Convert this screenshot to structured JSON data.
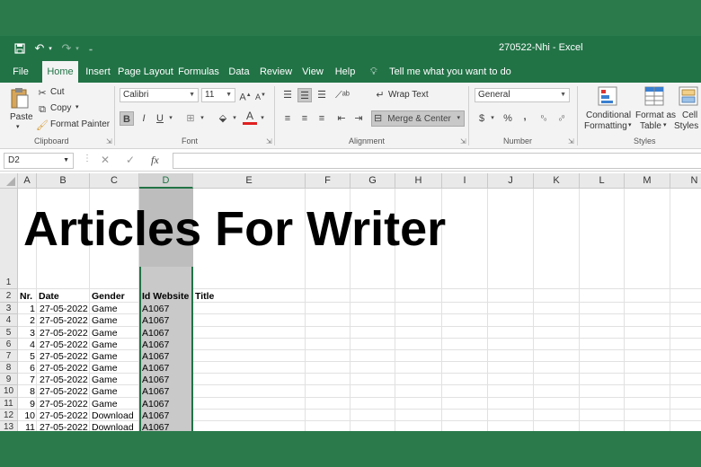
{
  "window": {
    "title": "270522-Nhi  -  Excel"
  },
  "tabs": [
    "File",
    "Home",
    "Insert",
    "Page Layout",
    "Formulas",
    "Data",
    "Review",
    "View",
    "Help"
  ],
  "tell_me": "Tell me what you want to do",
  "ribbon": {
    "clipboard": {
      "label": "Clipboard",
      "paste": "Paste",
      "cut": "Cut",
      "copy": "Copy",
      "format_painter": "Format Painter"
    },
    "font": {
      "label": "Font",
      "family": "Calibri",
      "size": "11",
      "bold": "B",
      "italic": "I",
      "underline": "U"
    },
    "alignment": {
      "label": "Alignment",
      "wrap_text": "Wrap Text",
      "merge_center": "Merge & Center"
    },
    "number": {
      "label": "Number",
      "format": "General",
      "currency": "$",
      "percent": "%",
      "comma": ","
    },
    "styles": {
      "label": "Styles",
      "conditional": "Conditional",
      "formatting": "Formatting",
      "format_as": "Format as",
      "table": "Table",
      "cell": "Cell",
      "styles": "Styles"
    }
  },
  "formula_bar": {
    "name_box": "D2",
    "fx": "fx",
    "value": ""
  },
  "columns": [
    "A",
    "B",
    "C",
    "D",
    "E",
    "F",
    "G",
    "H",
    "I",
    "J",
    "K",
    "L",
    "M",
    "N"
  ],
  "rows": [
    "1",
    "2",
    "3",
    "4",
    "5",
    "6",
    "7",
    "8",
    "9",
    "10",
    "11",
    "12",
    "13"
  ],
  "sheet": {
    "title": "Articles For Writer",
    "headers": {
      "nr": "Nr.",
      "date": "Date",
      "gender": "Gender",
      "id": "Id Website",
      "title": "Title"
    },
    "data": [
      {
        "nr": "1",
        "date": "27-05-2022",
        "gender": "Game",
        "id": "A1067"
      },
      {
        "nr": "2",
        "date": "27-05-2022",
        "gender": "Game",
        "id": "A1067"
      },
      {
        "nr": "3",
        "date": "27-05-2022",
        "gender": "Game",
        "id": "A1067"
      },
      {
        "nr": "4",
        "date": "27-05-2022",
        "gender": "Game",
        "id": "A1067"
      },
      {
        "nr": "5",
        "date": "27-05-2022",
        "gender": "Game",
        "id": "A1067"
      },
      {
        "nr": "6",
        "date": "27-05-2022",
        "gender": "Game",
        "id": "A1067"
      },
      {
        "nr": "7",
        "date": "27-05-2022",
        "gender": "Game",
        "id": "A1067"
      },
      {
        "nr": "8",
        "date": "27-05-2022",
        "gender": "Game",
        "id": "A1067"
      },
      {
        "nr": "9",
        "date": "27-05-2022",
        "gender": "Game",
        "id": "A1067"
      },
      {
        "nr": "10",
        "date": "27-05-2022",
        "gender": "Download",
        "id": "A1067"
      },
      {
        "nr": "11",
        "date": "27-05-2022",
        "gender": "Download",
        "id": "A1067"
      }
    ]
  },
  "colors": {
    "excel_green": "#217346",
    "frame_green": "#2a7a4c"
  }
}
